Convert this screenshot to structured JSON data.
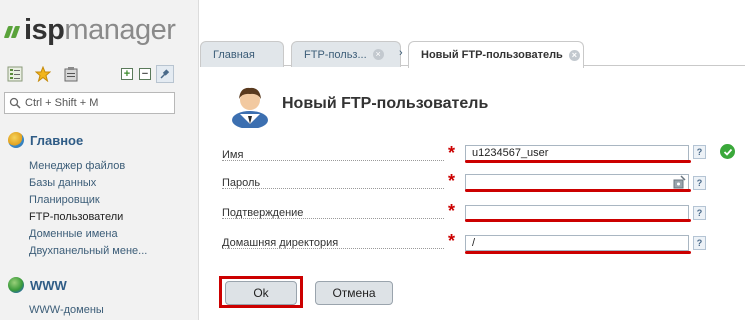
{
  "brand": {
    "logo_bold": "isp",
    "logo_light": "manager"
  },
  "sidebar": {
    "search_placeholder": "Ctrl + Shift + M",
    "sections": [
      {
        "title": "Главное",
        "items": [
          "Менеджер файлов",
          "Базы данных",
          "Планировщик",
          "FTP-пользователи",
          "Доменные имена",
          "Двухпанельный мене..."
        ]
      },
      {
        "title": "WWW",
        "items": [
          "WWW-домены"
        ]
      }
    ],
    "active_item": "FTP-пользователи"
  },
  "tabs": [
    {
      "label": "Главная",
      "closable": false
    },
    {
      "label": "FTP-польз...",
      "closable": true
    },
    {
      "label": "Новый FTP-пользователь",
      "closable": true,
      "active": true
    }
  ],
  "form": {
    "title": "Новый FTP-пользователь",
    "required_mark": "*",
    "help_mark": "?",
    "fields": [
      {
        "label": "Имя",
        "value": "u1234567_user",
        "status": "ok"
      },
      {
        "label": "Пароль",
        "value": ""
      },
      {
        "label": "Подтверждение",
        "value": ""
      },
      {
        "label": "Домашняя директория",
        "value": "/"
      }
    ],
    "ok_label": "Ok",
    "cancel_label": "Отмена"
  },
  "colors": {
    "accent_green": "#5aa33b",
    "highlight_red": "#cc0000",
    "link_blue": "#3c5d78"
  }
}
